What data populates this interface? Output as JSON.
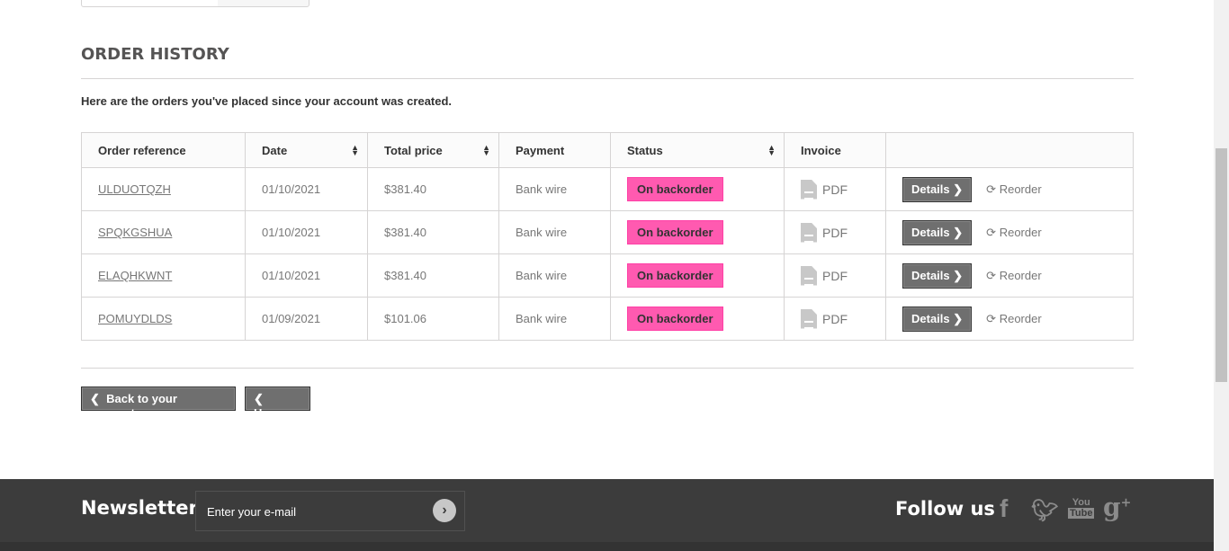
{
  "title": "ORDER HISTORY",
  "intro": "Here are the orders you've placed since your account was created.",
  "headers": [
    "Order reference",
    "Date",
    "Total price",
    "Payment",
    "Status",
    "Invoice"
  ],
  "orders": [
    {
      "ref": "ULDUOTQZH",
      "date": "01/10/2021",
      "total": "$381.40",
      "payment": "Bank wire",
      "status": "On backorder",
      "invoice": "PDF"
    },
    {
      "ref": "SPQKGSHUA",
      "date": "01/10/2021",
      "total": "$381.40",
      "payment": "Bank wire",
      "status": "On backorder",
      "invoice": "PDF"
    },
    {
      "ref": "ELAQHKWNT",
      "date": "01/10/2021",
      "total": "$381.40",
      "payment": "Bank wire",
      "status": "On backorder",
      "invoice": "PDF"
    },
    {
      "ref": "POMUYDLDS",
      "date": "01/09/2021",
      "total": "$101.06",
      "payment": "Bank wire",
      "status": "On backorder",
      "invoice": "PDF"
    }
  ],
  "details_label": "Details",
  "reorder_label": "Reorder",
  "back_label": "Back to your account.",
  "home_label": "Home",
  "footer": {
    "newsletter": "Newsletter",
    "email_placeholder": "Enter your e-mail",
    "follow": "Follow us"
  },
  "colors": {
    "status": "#ff5ab0",
    "footer": "#3c3c3c"
  }
}
